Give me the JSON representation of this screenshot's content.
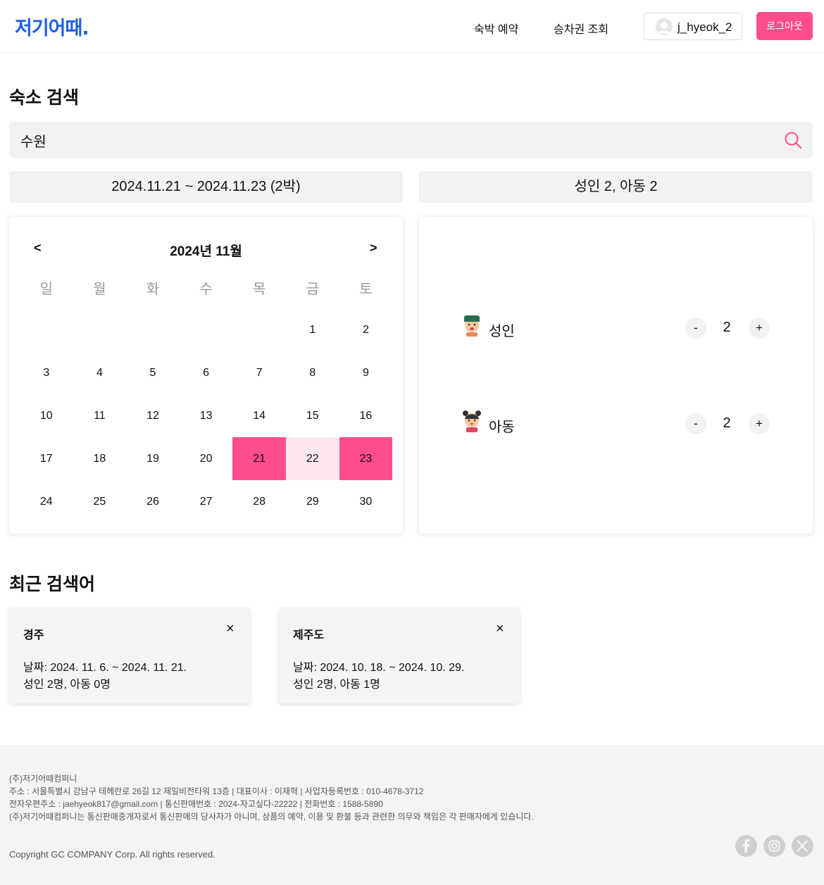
{
  "header": {
    "logo": "저기어때.",
    "nav": [
      "숙박 예약",
      "승차권 조회"
    ],
    "username": "j_hyeok_2",
    "logout": "로그아웃"
  },
  "search": {
    "title": "숙소 검색",
    "query": "수원",
    "date_range": "2024.11.21 ~ 2024.11.23 (2박)",
    "guests_summary": "성인 2, 아동 2"
  },
  "calendar": {
    "prev": "<",
    "next": ">",
    "title": "2024년 11월",
    "weekdays": [
      "일",
      "월",
      "화",
      "수",
      "목",
      "금",
      "토"
    ],
    "weeks": [
      [
        "",
        "",
        "",
        "",
        "",
        "1",
        "2"
      ],
      [
        "3",
        "4",
        "5",
        "6",
        "7",
        "8",
        "9"
      ],
      [
        "10",
        "11",
        "12",
        "13",
        "14",
        "15",
        "16"
      ],
      [
        "17",
        "18",
        "19",
        "20",
        "21",
        "22",
        "23"
      ],
      [
        "24",
        "25",
        "26",
        "27",
        "28",
        "29",
        "30"
      ]
    ],
    "check_in": "21",
    "check_out": "23",
    "in_range": [
      "22"
    ],
    "accent_color": "#fe4d8c",
    "range_color": "#fde7ef"
  },
  "guests": {
    "adult": {
      "label": "성인",
      "count": "2",
      "minus": "-",
      "plus": "+"
    },
    "child": {
      "label": "아동",
      "count": "2",
      "minus": "-",
      "plus": "+"
    }
  },
  "recent": {
    "title": "최근 검색어",
    "close": "×",
    "items": [
      {
        "place": "경주",
        "dates": "날짜: 2024. 11. 6. ~ 2024. 11. 21.",
        "guests": "성인 2명, 아동 0명"
      },
      {
        "place": "제주도",
        "dates": "날짜: 2024. 10. 18. ~ 2024. 10. 29.",
        "guests": "성인 2명, 아동 1명"
      }
    ]
  },
  "footer": {
    "lines": [
      "(주)저기어때컴퍼니",
      "주소 : 서울특별시 강남구 테헤란로 26길 12 제일비전타워 13층 | 대표이사 : 이재혁 | 사업자등록번호 : 010-4678-3712",
      "전자우편주소 : jaehyeok817@gmail.com | 통신판매번호 : 2024-자고싶다-22222 | 전화번호 : 1588-5890",
      "(주)저기어때컴퍼니는 통신판매중개자로서 통신판매의 당사자가 아니며, 상품의 예약, 이용 및 환불 등과 관련한 의무와 책임은 각 판매자에게 있습니다."
    ],
    "copyright": "Copyright GC COMPANY Corp. All rights reserved.",
    "social_icons": [
      "facebook-icon",
      "instagram-icon",
      "x-icon"
    ]
  },
  "colors": {
    "brand": "#1e5ee6",
    "accent": "#fe4d8c"
  }
}
